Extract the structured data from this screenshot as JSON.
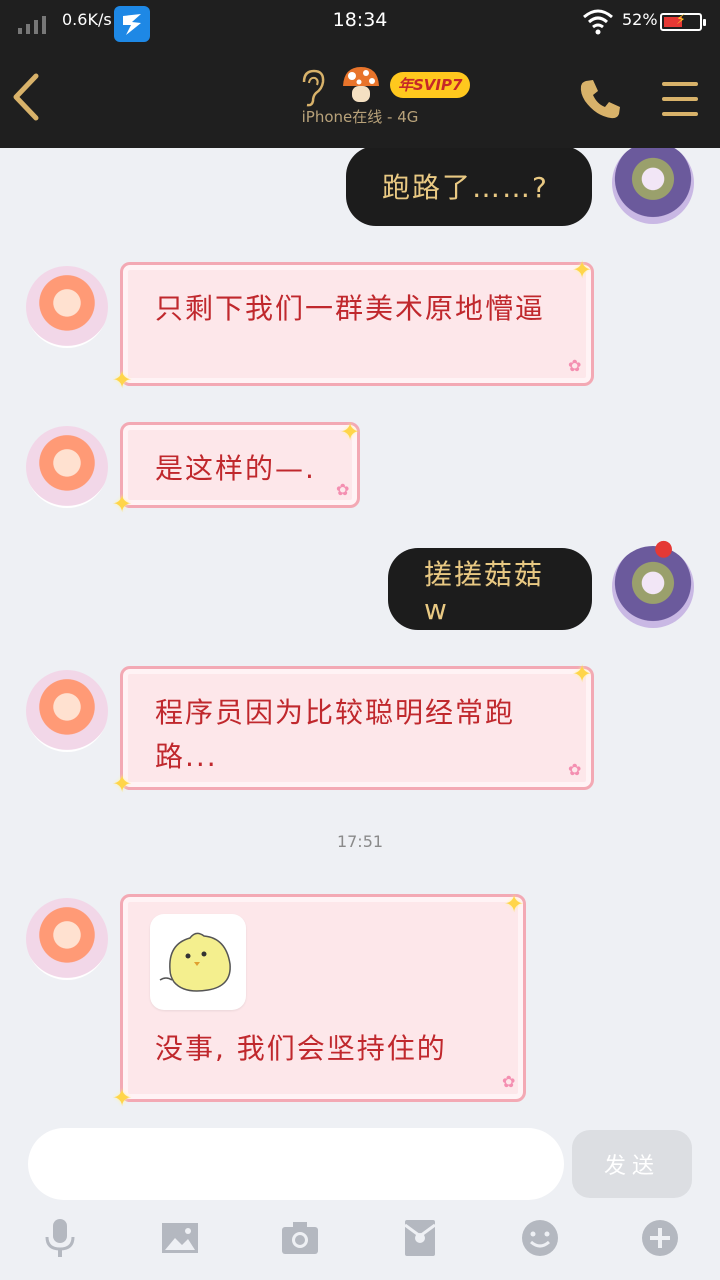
{
  "status_bar": {
    "speed": "0.6K/s",
    "time": "18:34",
    "battery": "52%"
  },
  "header": {
    "vip_badge": "年SVIP7",
    "status": "iPhone在线 - 4G"
  },
  "messages": [
    {
      "side": "right",
      "style": "dark",
      "text": "跑路了……?"
    },
    {
      "side": "left",
      "style": "pink",
      "text": "只剩下我们一群美术原地懵逼"
    },
    {
      "side": "left",
      "style": "pink",
      "text": "是这样的—."
    },
    {
      "side": "right",
      "style": "dark",
      "text": "搓搓菇菇w"
    },
    {
      "side": "left",
      "style": "pink",
      "text": "程序员因为比较聪明经常跑路..."
    },
    {
      "side": "left",
      "style": "pink",
      "has_sticker": true,
      "text": "没事, 我们会坚持住的"
    }
  ],
  "timestamp": "17:51",
  "input": {
    "send_label": "发送"
  },
  "toolbar": [
    "mic-icon",
    "image-icon",
    "camera-icon",
    "red-packet-icon",
    "emoji-icon",
    "plus-icon"
  ],
  "colors": {
    "bar_bg": "#1f1f1f",
    "gold": "#d8b26a",
    "chat_bg": "#eef0f4",
    "pink_bubble": "#fde7ea",
    "pink_text": "#c0282d",
    "dark_bubble_text": "#e9c983"
  }
}
